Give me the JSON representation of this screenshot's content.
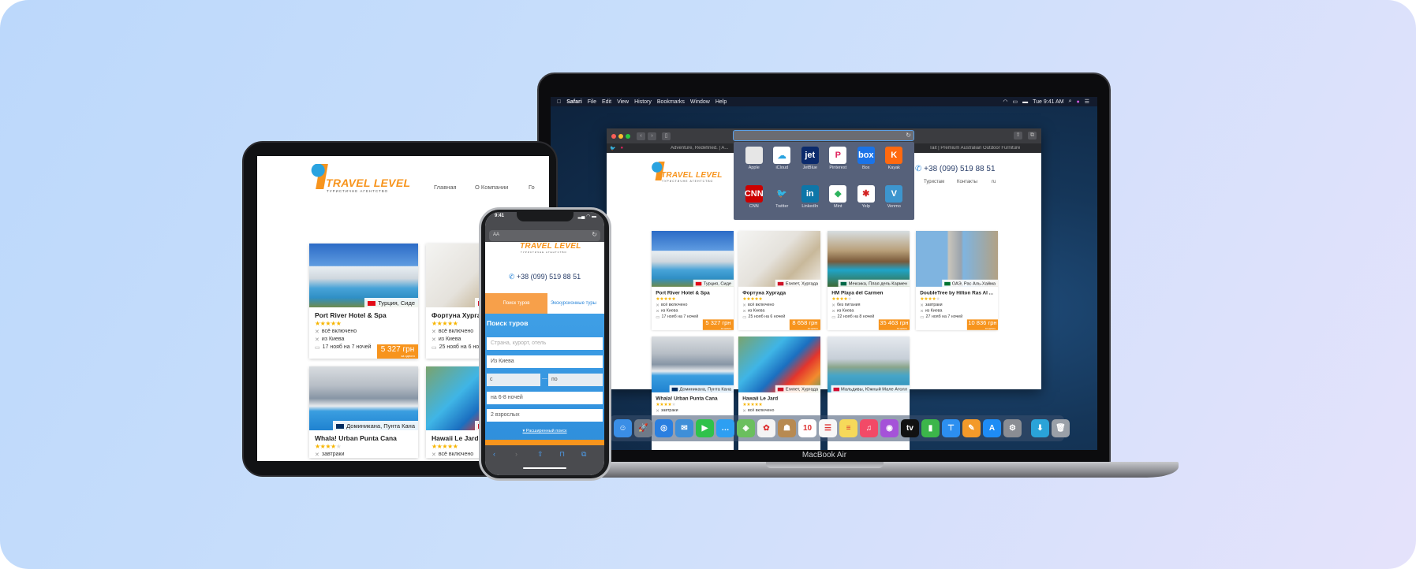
{
  "brand": {
    "name": "TRAVEL LEVEL",
    "tagline": "ТУРИСТИЧНЕ АГЕНТСТВО",
    "phone": "+38 (099) 519 88 51",
    "accent": "#f7941d",
    "link": "#2a86d9"
  },
  "macos": {
    "menu": [
      "Safari",
      "File",
      "Edit",
      "View",
      "History",
      "Bookmarks",
      "Window",
      "Help"
    ],
    "clock": "Tue 9:41 AM",
    "device_label": "MacBook Air",
    "dock": [
      {
        "icon": "finder-icon",
        "color": "#3a8ee6",
        "glyph": "☺"
      },
      {
        "icon": "launchpad-icon",
        "color": "#6f7a88",
        "glyph": "🚀"
      },
      {
        "icon": "safari-icon",
        "color": "#2a7fe0",
        "glyph": "◎"
      },
      {
        "icon": "mail-icon",
        "color": "#3f8fd8",
        "glyph": "✉"
      },
      {
        "icon": "facetime-icon",
        "color": "#2fc24a",
        "glyph": "▶"
      },
      {
        "icon": "messages-icon",
        "color": "#2d9ff2",
        "glyph": "…"
      },
      {
        "icon": "maps-icon",
        "color": "#6bbf5e",
        "glyph": "◈"
      },
      {
        "icon": "photos-icon",
        "color": "#f4f4f4",
        "glyph": "✿"
      },
      {
        "icon": "contacts-icon",
        "color": "#b78a52",
        "glyph": "☗"
      },
      {
        "icon": "calendar-icon",
        "color": "#ffffff",
        "glyph": "10"
      },
      {
        "icon": "reminders-icon",
        "color": "#f7f7f7",
        "glyph": "☰"
      },
      {
        "icon": "notes-icon",
        "color": "#f6d95a",
        "glyph": "≡"
      },
      {
        "icon": "music-icon",
        "color": "#f24a67",
        "glyph": "♫"
      },
      {
        "icon": "podcasts-icon",
        "color": "#a552d8",
        "glyph": "◉"
      },
      {
        "icon": "tv-icon",
        "color": "#111111",
        "glyph": "tv"
      },
      {
        "icon": "numbers-icon",
        "color": "#3cb64a",
        "glyph": "▮"
      },
      {
        "icon": "keynote-icon",
        "color": "#2c8ff0",
        "glyph": "⊤"
      },
      {
        "icon": "pages-icon",
        "color": "#f39a2a",
        "glyph": "✎"
      },
      {
        "icon": "app-store-icon",
        "color": "#1e8cf5",
        "glyph": "A"
      },
      {
        "icon": "system-preferences-icon",
        "color": "#8a8d93",
        "glyph": "⚙"
      },
      {
        "icon": "downloads-folder-icon",
        "color": "#2aa3d8",
        "glyph": "⬇"
      },
      {
        "icon": "trash-icon",
        "color": "#9aa0a8",
        "glyph": "🗑"
      }
    ]
  },
  "safari": {
    "tabs": [
      "Adventure, Redefined. | A...",
      "Tait | Premium Australian Outdoor Furniture"
    ],
    "favorites": [
      {
        "label": "Apple",
        "color": "#e6e6e6",
        "glyph": ""
      },
      {
        "label": "iCloud",
        "color": "#ffffff",
        "glyph": "☁"
      },
      {
        "label": "JetBlue",
        "color": "#0b2a6c",
        "glyph": "jet"
      },
      {
        "label": "Pinterest",
        "color": "#ffffff",
        "glyph": "P"
      },
      {
        "label": "Box",
        "color": "#1a73e8",
        "glyph": "box"
      },
      {
        "label": "Kayak",
        "color": "#ff690f",
        "glyph": "K"
      },
      {
        "label": "CNN",
        "color": "#cc0000",
        "glyph": "CNN"
      },
      {
        "label": "Twitter",
        "color": "#56617a",
        "glyph": "🐦"
      },
      {
        "label": "LinkedIn",
        "color": "#0e76a8",
        "glyph": "in"
      },
      {
        "label": "Mint",
        "color": "#ffffff",
        "glyph": "◆"
      },
      {
        "label": "Yelp",
        "color": "#ffffff",
        "glyph": "✱"
      },
      {
        "label": "Venmo",
        "color": "#3d95ce",
        "glyph": "V"
      }
    ]
  },
  "site": {
    "nav": [
      "Главная",
      "О Компании",
      "Го",
      "Туристам",
      "Контакты",
      "ru"
    ],
    "per_person": "за одного",
    "hotels": [
      {
        "name": "Port River Hotel & Spa",
        "location": "Турция, Сиде",
        "stars": 5,
        "meal": "всё включено",
        "from": "из Киева",
        "dates": "17 нояб на 7 ночей",
        "price": "5 327 грн",
        "flag": "#e30a17"
      },
      {
        "name": "Фортуна Хургада",
        "location": "Египет, Хургада",
        "stars": 5,
        "meal": "всё включено",
        "from": "из Киева",
        "dates": "25 нояб на 6 ночей",
        "price": "8 658 грн",
        "flag": "#ce1126"
      },
      {
        "name": "HM Playa del Carmen",
        "location": "Мексика, Плая дель Кармен",
        "stars": 4,
        "meal": "без питания",
        "from": "из Киева",
        "dates": "22 нояб на 8 ночей",
        "price": "35 463 грн",
        "flag": "#006847"
      },
      {
        "name": "DoubleTree by Hilton Ras Al ...",
        "location": "ОАЭ, Рас Аль-Хайма",
        "stars": 4,
        "meal": "завтраки",
        "from": "из Киева",
        "dates": "27 нояб на 7 ночей",
        "price": "10 836 грн",
        "flag": "#00732f"
      },
      {
        "name": "Whala! Urban Punta Cana",
        "location": "Доминикана, Пунта Кана",
        "stars": 4,
        "meal": "завтраки",
        "flag": "#002d62"
      },
      {
        "name": "Hawaii Le Jard",
        "location": "Египет, Хургада",
        "stars": 5,
        "meal": "всё включено",
        "flag": "#ce1126"
      },
      {
        "name": "",
        "location": "Мальдивы, Южный Мале Атолл",
        "stars": 0,
        "meal": "",
        "flag": "#d21034"
      }
    ]
  },
  "iphone": {
    "time": "9:41",
    "url_label": "AA",
    "tabs": [
      "Поиск туров",
      "Экскурсионные туры"
    ],
    "form": {
      "title": "Поиск туров",
      "destination_placeholder": "Страна, курорт, отель",
      "from": "Из Киева",
      "date_from": "с",
      "date_sep": "—",
      "date_to": "по",
      "nights": "на 6-8 ночей",
      "adults": "2 взрослых",
      "advanced": "▾ Расширенный поиск"
    }
  }
}
